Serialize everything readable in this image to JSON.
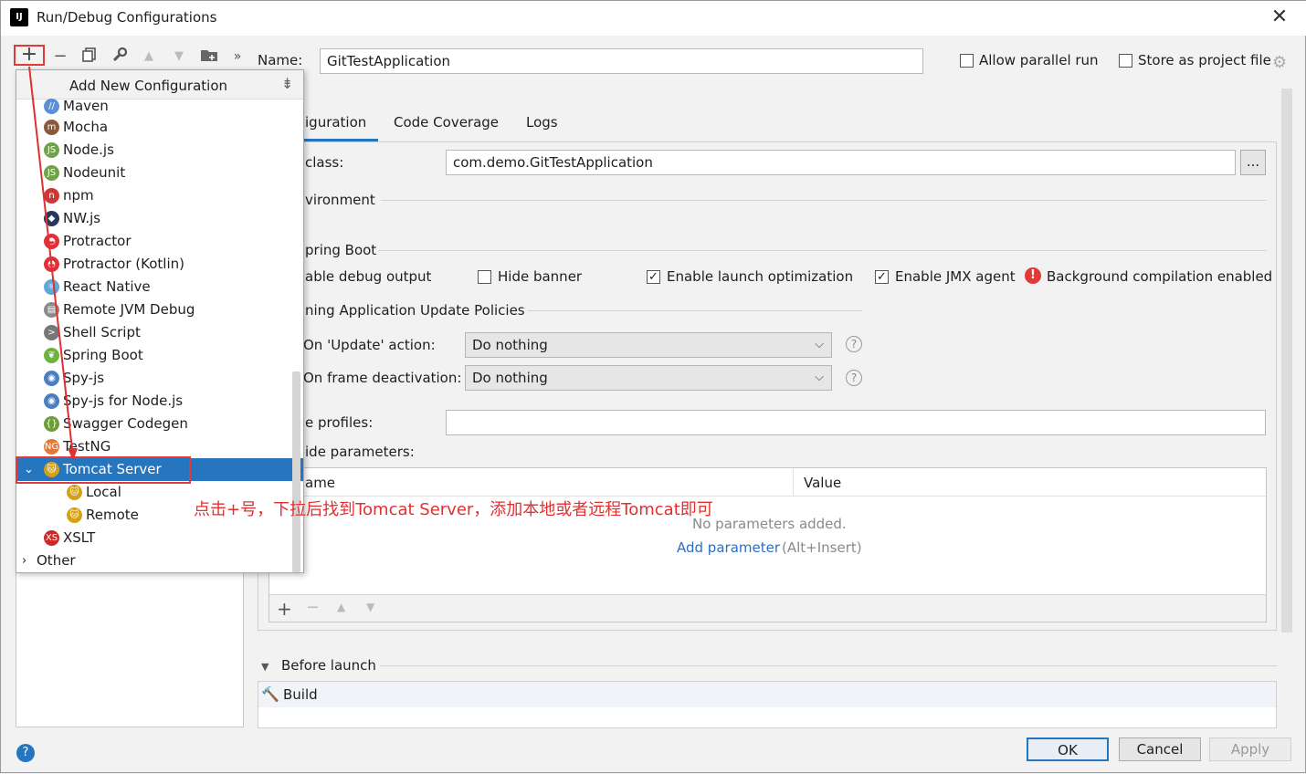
{
  "window": {
    "title": "Run/Debug Configurations",
    "app_icon": "IJ",
    "close": "✕"
  },
  "toolbar": {
    "add": "+",
    "remove": "−",
    "copy": "copy-icon",
    "wrench": "wrench-icon",
    "up": "▲",
    "down": "▼",
    "folder": "folder-icon",
    "more": "»"
  },
  "popup": {
    "title": "Add New Configuration",
    "items": [
      {
        "label": "Maven",
        "icon": "maven-icon",
        "glyph": "//",
        "color": "#5d8fd6"
      },
      {
        "label": "Mocha",
        "icon": "mocha-icon",
        "glyph": "m",
        "color": "#8b5a3c"
      },
      {
        "label": "Node.js",
        "icon": "nodejs-icon",
        "glyph": "JS",
        "color": "#6ea34a"
      },
      {
        "label": "Nodeunit",
        "icon": "nodeunit-icon",
        "glyph": "JS",
        "color": "#6ea34a"
      },
      {
        "label": "npm",
        "icon": "npm-icon",
        "glyph": "n",
        "color": "#cb3837"
      },
      {
        "label": "NW.js",
        "icon": "nwjs-icon",
        "glyph": "◆",
        "color": "#23395d"
      },
      {
        "label": "Protractor",
        "icon": "protractor-icon",
        "glyph": "◓",
        "color": "#e0303a"
      },
      {
        "label": "Protractor (Kotlin)",
        "icon": "protractor-kotlin-icon",
        "glyph": "◓",
        "color": "#e0303a"
      },
      {
        "label": "React Native",
        "icon": "react-icon",
        "glyph": "⚛",
        "color": "#61a6d8"
      },
      {
        "label": "Remote JVM Debug",
        "icon": "remote-debug-icon",
        "glyph": "▤",
        "color": "#8a8a8a"
      },
      {
        "label": "Shell Script",
        "icon": "shell-icon",
        "glyph": ">",
        "color": "#777"
      },
      {
        "label": "Spring Boot",
        "icon": "spring-boot-icon",
        "glyph": "❦",
        "color": "#6db33f"
      },
      {
        "label": "Spy-js",
        "icon": "spyjs-icon",
        "glyph": "◉",
        "color": "#4a7fc1"
      },
      {
        "label": "Spy-js for Node.js",
        "icon": "spyjs-node-icon",
        "glyph": "◉",
        "color": "#4a7fc1"
      },
      {
        "label": "Swagger Codegen",
        "icon": "swagger-icon",
        "glyph": "{}",
        "color": "#6d9c3b"
      },
      {
        "label": "TestNG",
        "icon": "testng-icon",
        "glyph": "NG",
        "color": "#e07a3a"
      },
      {
        "label": "Tomcat Server",
        "icon": "tomcat-icon",
        "glyph": "🐱",
        "color": "#d4a017"
      },
      {
        "label": "Local",
        "icon": "tomcat-local-icon",
        "glyph": "🐱",
        "color": "#d4a017"
      },
      {
        "label": "Remote",
        "icon": "tomcat-remote-icon",
        "glyph": "🐱",
        "color": "#d4a017"
      },
      {
        "label": "XSLT",
        "icon": "xslt-icon",
        "glyph": "XS",
        "color": "#cc2a2a"
      },
      {
        "label": "Other",
        "icon": "chevron-right-icon",
        "glyph": "›",
        "color": "#777"
      }
    ]
  },
  "name_row": {
    "label": "Name:",
    "value": "GitTestApplication",
    "allow_parallel": "Allow parallel run",
    "store_project": "Store as project file"
  },
  "tabs": [
    "iguration",
    "Code Coverage",
    "Logs"
  ],
  "main_class": {
    "label": "class:",
    "value": "com.demo.GitTestApplication",
    "browse": "..."
  },
  "environment": {
    "label": "vironment"
  },
  "spring_boot": {
    "label": "pring Boot",
    "debug_output": "able debug output",
    "hide_banner": "Hide banner",
    "launch_opt": "Enable launch optimization",
    "jmx_agent": "Enable JMX agent",
    "bg_compile": "Background compilation enabled"
  },
  "policies": {
    "label": "ning Application Update Policies",
    "update_label": "On 'Update' action:",
    "update_value": "Do nothing",
    "frame_label": "On frame deactivation:",
    "frame_value": "Do nothing",
    "help": "?"
  },
  "profiles": {
    "label": "e profiles:",
    "value": ""
  },
  "override": {
    "label": "ide parameters:",
    "col_name": "ame",
    "col_value": "Value",
    "empty": "No parameters added.",
    "add_link": "Add parameter",
    "add_shortcut": "(Alt+Insert)"
  },
  "before_launch": {
    "label": "Before launch",
    "item": "Build"
  },
  "buttons": {
    "ok": "OK",
    "cancel": "Cancel",
    "apply": "Apply",
    "help": "?"
  },
  "annotation": "点击+号，下拉后找到Tomcat Server，添加本地或者远程Tomcat即可",
  "colors": {
    "accent": "#2675bf",
    "annotation": "#e03030",
    "error": "#e0393a"
  }
}
